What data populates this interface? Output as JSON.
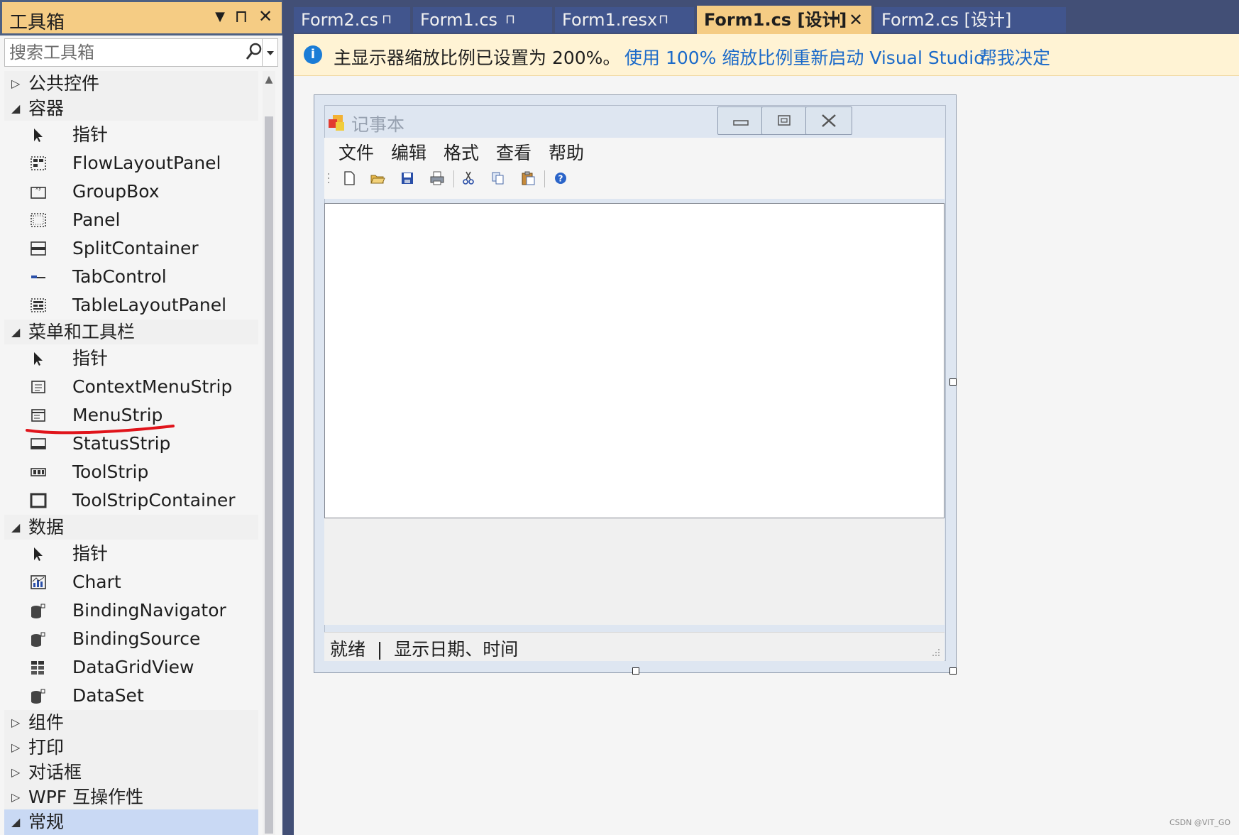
{
  "toolbox": {
    "title": "工具箱",
    "title_buttons": {
      "dropdown": "▼",
      "pin": "⊓",
      "close": "✕"
    },
    "search_placeholder": "搜索工具箱",
    "categories": [
      {
        "label": "公共控件",
        "expanded": false
      },
      {
        "label": "容器",
        "expanded": true,
        "items": [
          "指针",
          "FlowLayoutPanel",
          "GroupBox",
          "Panel",
          "SplitContainer",
          "TabControl",
          "TableLayoutPanel"
        ]
      },
      {
        "label": "菜单和工具栏",
        "expanded": true,
        "items": [
          "指针",
          "ContextMenuStrip",
          "MenuStrip",
          "StatusStrip",
          "ToolStrip",
          "ToolStripContainer"
        ]
      },
      {
        "label": "数据",
        "expanded": true,
        "items": [
          "指针",
          "Chart",
          "BindingNavigator",
          "BindingSource",
          "DataGridView",
          "DataSet"
        ]
      },
      {
        "label": "组件",
        "expanded": false
      },
      {
        "label": "打印",
        "expanded": false
      },
      {
        "label": "对话框",
        "expanded": false
      },
      {
        "label": "WPF 互操作性",
        "expanded": false
      },
      {
        "label": "常规",
        "expanded": true,
        "selected": true
      }
    ]
  },
  "tabs": [
    {
      "label": "Form2.cs",
      "active": false,
      "pin": "⊓"
    },
    {
      "label": "Form1.cs",
      "active": false,
      "pin": "⊓"
    },
    {
      "label": "Form1.resx",
      "active": false,
      "pin": "⊓"
    },
    {
      "label": "Form1.cs [设计]",
      "active": true,
      "pin": "⊣",
      "close": "✕"
    },
    {
      "label": "Form2.cs [设计]",
      "active": false
    }
  ],
  "infobar": {
    "icon": "i",
    "message": "主显示器缩放比例已设置为 200%。",
    "link1": "使用 100% 缩放比例重新启动 Visual Studio",
    "link2": "帮我决定"
  },
  "form": {
    "title": "记事本",
    "menus": [
      "文件",
      "编辑",
      "格式",
      "查看",
      "帮助"
    ],
    "toolstrip_icons": [
      "new-icon",
      "open-icon",
      "save-icon",
      "print-icon",
      "cut-icon",
      "copy-icon",
      "paste-icon",
      "help-icon"
    ],
    "textbox_value": "",
    "status": "就绪  |  显示日期、时间"
  },
  "watermark": "CSDN @VIT_GO",
  "colors": {
    "tab_bar": "#424f76",
    "tab_inactive": "#41558d",
    "tab_active": "#f5cc84",
    "infobar_bg": "#fff3d4",
    "link": "#1b6ac9",
    "annotation": "#e0141b"
  }
}
